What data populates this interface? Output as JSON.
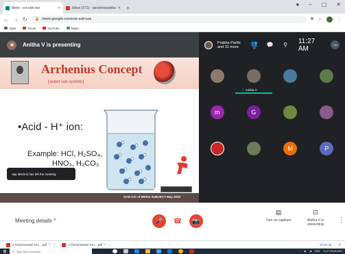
{
  "browser": {
    "tabs": [
      {
        "title": "Meet - cot-sxtt-sox",
        "active": true,
        "favicon_color": "#00897b"
      },
      {
        "title": "Inbox (271) - parameswarikarayi...",
        "active": false,
        "favicon_color": "#d93025"
      }
    ],
    "new_tab": "+",
    "url": "meet.google.com/cot-sxtt-sox",
    "bookmarks": [
      {
        "label": "Apps",
        "color": "#5f6368"
      },
      {
        "label": "Gmail",
        "color": "#d93025"
      },
      {
        "label": "YouTube",
        "color": "#ff0000"
      },
      {
        "label": "Maps",
        "color": "#34a853"
      }
    ]
  },
  "meet": {
    "presenting_label": "Anitha V is presenting",
    "participants_summary": "Prabha Parthi and 31 more",
    "participants_count": "32",
    "clock": "11:27 AM",
    "you_label": "You",
    "grid": [
      {
        "type": "photo",
        "color": "#8e7a6a"
      },
      {
        "type": "photo",
        "color": "#7b6c63",
        "speaking": true,
        "name": "Anitha V"
      },
      {
        "type": "photo",
        "color": "#4a7a9c"
      },
      {
        "type": "photo",
        "color": "#5d7a4a"
      },
      {
        "type": "letter",
        "letter": "m",
        "color": "#9c27b0"
      },
      {
        "type": "letter",
        "letter": "G",
        "color": "#7b1fa2"
      },
      {
        "type": "photo",
        "color": "#6f8a3f"
      },
      {
        "type": "photo",
        "color": "#8a5a8a"
      },
      {
        "type": "logo",
        "color": "#c62828"
      },
      {
        "type": "photo",
        "color": "#6b7a5a"
      },
      {
        "type": "letter",
        "letter": "M",
        "color": "#ef6c00"
      },
      {
        "type": "letter",
        "letter": "P",
        "color": "#5c6bc0"
      }
    ]
  },
  "slide": {
    "title": "Arrhenius Concept",
    "subtitle": "(water ion system)",
    "bullet": "•Acid - H⁺ ion:",
    "example_line1": "Example: HCl, H₂SO₄,",
    "example_line2": "HNO₃, H₂CO₃",
    "footer": "GAD C/C of MKKG SUBJECT May 2020",
    "badge": "",
    "toast": "raja lakshmi has left the meeting"
  },
  "controls": {
    "meeting_details": "Meeting details",
    "captions_label": "Turn on captions",
    "presenting_label": "Anitha V is presenting"
  },
  "downloads": {
    "items": [
      {
        "name": "A.Parameswari Pro....pdf"
      },
      {
        "name": "A.Parameswari Pro....pdf"
      }
    ],
    "show_all": "Show all"
  },
  "taskbar": {
    "search_placeholder": "Type here to search",
    "clock": "11:27",
    "date": "25-05-2021",
    "lang": "ENG"
  }
}
